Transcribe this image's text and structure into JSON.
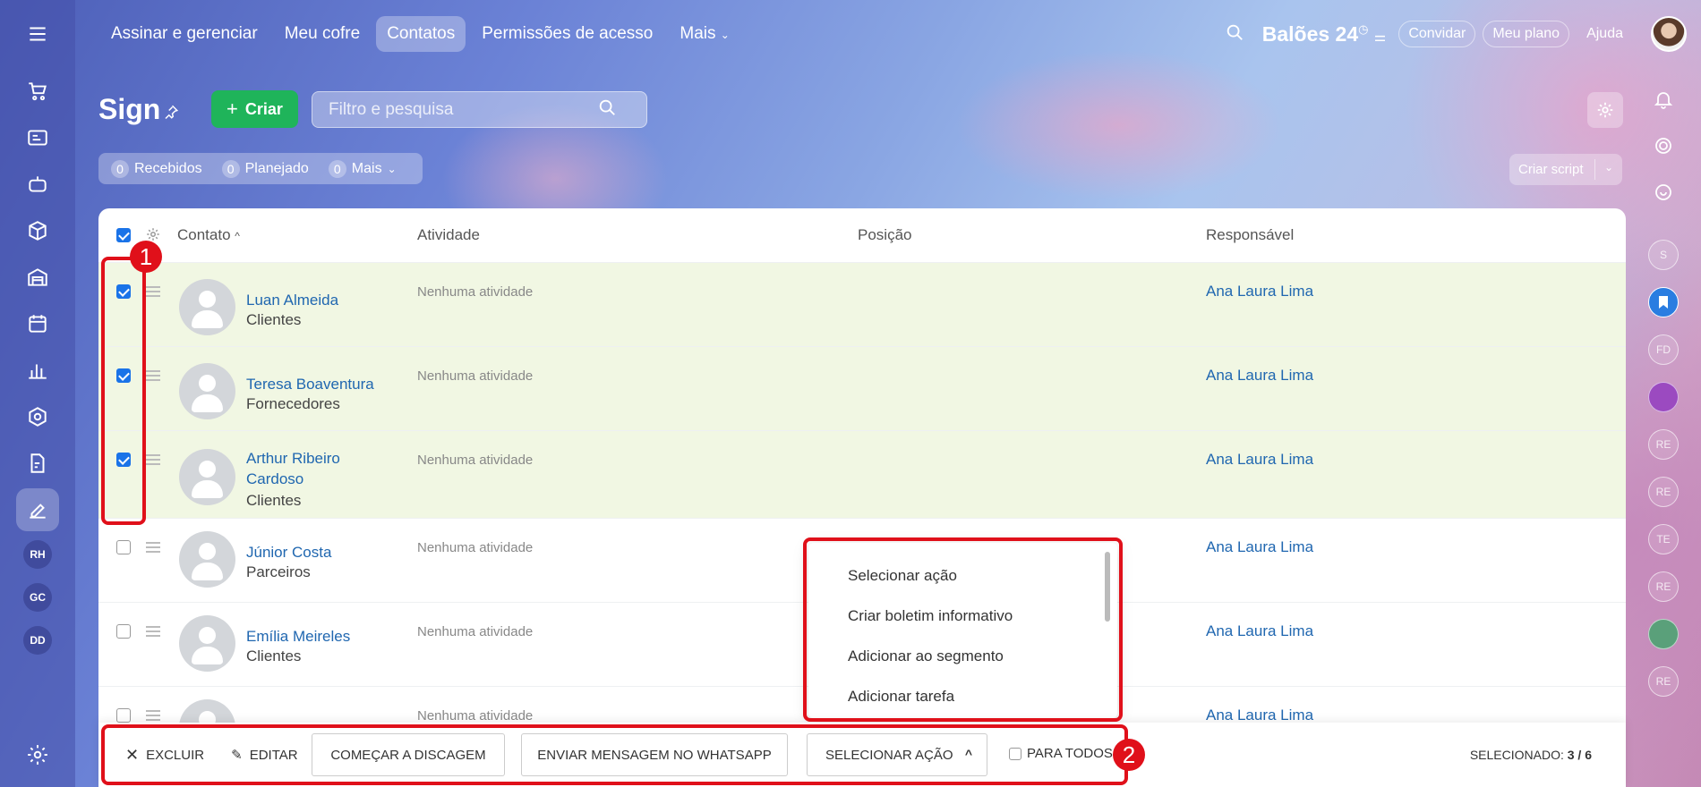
{
  "topbar": {
    "nav": [
      "Assinar e gerenciar",
      "Meu cofre",
      "Contatos",
      "Permissões de acesso",
      "Mais"
    ],
    "active_index": 2,
    "brand": "Balões 24",
    "invite": "Convidar",
    "my_plan": "Meu plano",
    "help": "Ajuda"
  },
  "left_rail": {
    "avatars": [
      "RH",
      "GC",
      "DD"
    ]
  },
  "right_rail": {
    "avatars": [
      "S",
      "FD",
      "RE",
      "RE",
      "TE",
      "RE",
      "RE"
    ]
  },
  "header": {
    "title": "Sign",
    "create_label": "Criar",
    "search_placeholder": "Filtro e pesquisa",
    "criar_script": "Criar script"
  },
  "counters": [
    {
      "count": "0",
      "label": "Recebidos"
    },
    {
      "count": "0",
      "label": "Planejado"
    },
    {
      "count": "0",
      "label": "Mais"
    }
  ],
  "grid": {
    "columns": [
      "Contato",
      "Atividade",
      "Posição",
      "Responsável"
    ],
    "rows": [
      {
        "name": "Luan Almeida",
        "type": "Clientes",
        "activity": "Nenhuma atividade",
        "owner": "Ana Laura Lima",
        "selected": true
      },
      {
        "name": "Teresa Boaventura",
        "type": "Fornecedores",
        "activity": "Nenhuma atividade",
        "owner": "Ana Laura Lima",
        "selected": true
      },
      {
        "name": "Arthur Ribeiro Cardoso",
        "type": "Clientes",
        "activity": "Nenhuma atividade",
        "owner": "Ana Laura Lima",
        "selected": true
      },
      {
        "name": "Júnior Costa",
        "type": "Parceiros",
        "activity": "Nenhuma atividade",
        "owner": "Ana Laura Lima",
        "selected": false
      },
      {
        "name": "Emília Meireles",
        "type": "Clientes",
        "activity": "Nenhuma atividade",
        "owner": "Ana Laura Lima",
        "selected": false
      },
      {
        "name": "",
        "type": "",
        "activity": "Nenhuma atividade",
        "owner": "Ana Laura Lima",
        "selected": false
      }
    ]
  },
  "dropdown": {
    "items": [
      "Selecionar ação",
      "Criar boletim informativo",
      "Adicionar ao segmento",
      "Adicionar tarefa"
    ]
  },
  "bottom_panel": {
    "delete": "Excluir",
    "edit": "Editar",
    "dial": "Começar a discagem",
    "whatsapp": "Enviar mensagem no WhatsApp",
    "select_action": "Selecionar ação",
    "for_all": "Para todos",
    "selected_label": "Selecionado:",
    "selected_value": "3 / 6"
  },
  "annotations": [
    "1",
    "2"
  ],
  "colors": {
    "accent_blue": "#2067b0",
    "create_green": "#1fb45a",
    "annotation_red": "#e0101a",
    "selected_row": "#f1f7e3"
  }
}
